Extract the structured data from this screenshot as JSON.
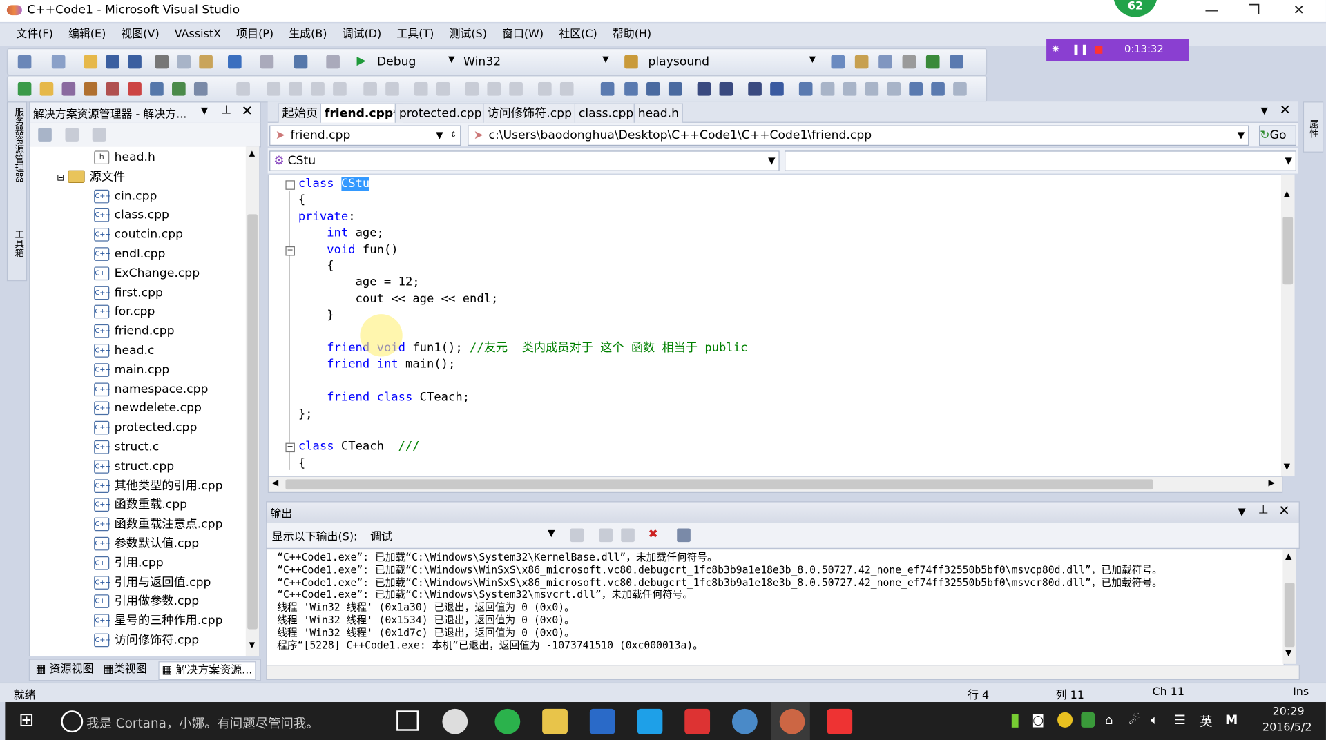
{
  "window": {
    "title": "C++Code1 - Microsoft Visual Studio",
    "badge": "62"
  },
  "menu": [
    "文件(F)",
    "编辑(E)",
    "视图(V)",
    "VAssistX",
    "项目(P)",
    "生成(B)",
    "调试(D)",
    "工具(T)",
    "测试(S)",
    "窗口(W)",
    "社区(C)",
    "帮助(H)"
  ],
  "toolbar": {
    "config": "Debug",
    "platform": "Win32",
    "find": "playsound"
  },
  "recorder": {
    "time": "0:13:32"
  },
  "solution_explorer": {
    "title": "解决方案资源管理器 - 解决方...",
    "items": [
      {
        "label": "head.h",
        "icon": "h"
      },
      {
        "label": "源文件",
        "icon": "folder"
      },
      {
        "label": "cin.cpp",
        "icon": "cpp"
      },
      {
        "label": "class.cpp",
        "icon": "cpp"
      },
      {
        "label": "coutcin.cpp",
        "icon": "cpp"
      },
      {
        "label": "endl.cpp",
        "icon": "cpp"
      },
      {
        "label": "ExChange.cpp",
        "icon": "cpp"
      },
      {
        "label": "first.cpp",
        "icon": "cpp"
      },
      {
        "label": "for.cpp",
        "icon": "cpp"
      },
      {
        "label": "friend.cpp",
        "icon": "cpp"
      },
      {
        "label": "head.c",
        "icon": "cpp"
      },
      {
        "label": "main.cpp",
        "icon": "cpp"
      },
      {
        "label": "namespace.cpp",
        "icon": "cpp"
      },
      {
        "label": "newdelete.cpp",
        "icon": "cpp"
      },
      {
        "label": "protected.cpp",
        "icon": "cpp"
      },
      {
        "label": "struct.c",
        "icon": "cpp"
      },
      {
        "label": "struct.cpp",
        "icon": "cpp"
      },
      {
        "label": "其他类型的引用.cpp",
        "icon": "cpp"
      },
      {
        "label": "函数重载.cpp",
        "icon": "cpp"
      },
      {
        "label": "函数重载注意点.cpp",
        "icon": "cpp"
      },
      {
        "label": "参数默认值.cpp",
        "icon": "cpp"
      },
      {
        "label": "引用.cpp",
        "icon": "cpp"
      },
      {
        "label": "引用与返回值.cpp",
        "icon": "cpp"
      },
      {
        "label": "引用做参数.cpp",
        "icon": "cpp"
      },
      {
        "label": "星号的三种作用.cpp",
        "icon": "cpp"
      },
      {
        "label": "访问修饰符.cpp",
        "icon": "cpp"
      }
    ],
    "bottom_tabs": [
      "资源视图",
      "类视图",
      "解决方案资源..."
    ]
  },
  "left_strip": [
    "服务器资源管理器",
    "工具箱"
  ],
  "right_strip": [
    "属性"
  ],
  "editor": {
    "tabs": [
      "起始页",
      "friend.cpp*",
      "protected.cpp",
      "访问修饰符.cpp",
      "class.cpp",
      "head.h"
    ],
    "file_combo": "friend.cpp",
    "path": "c:\\Users\\baodonghua\\Desktop\\C++Code1\\C++Code1\\friend.cpp",
    "go": "Go",
    "class_combo": "CStu",
    "code": [
      {
        "parts": [
          [
            "kw",
            "class "
          ],
          [
            "sel",
            "CStu"
          ]
        ]
      },
      {
        "parts": [
          [
            "",
            "{"
          ]
        ]
      },
      {
        "parts": [
          [
            "kw",
            "private"
          ],
          [
            "",
            ":"
          ]
        ]
      },
      {
        "parts": [
          [
            "",
            "    "
          ],
          [
            "kw",
            "int"
          ],
          [
            "",
            " age;"
          ]
        ]
      },
      {
        "parts": [
          [
            "",
            "    "
          ],
          [
            "kw",
            "void"
          ],
          [
            "",
            " fun()"
          ]
        ]
      },
      {
        "parts": [
          [
            "",
            "    {"
          ]
        ]
      },
      {
        "parts": [
          [
            "",
            "        age = 12;"
          ]
        ]
      },
      {
        "parts": [
          [
            "",
            "        cout << age << endl;"
          ]
        ]
      },
      {
        "parts": [
          [
            "",
            "    }"
          ]
        ]
      },
      {
        "parts": [
          [
            "",
            ""
          ]
        ]
      },
      {
        "parts": [
          [
            "",
            "    "
          ],
          [
            "kw",
            "friend"
          ],
          [
            "",
            " "
          ],
          [
            "kw",
            "void"
          ],
          [
            "",
            " fun1(); "
          ],
          [
            "cm",
            "//友元  类内成员对于 这个 函数 相当于 public"
          ]
        ]
      },
      {
        "parts": [
          [
            "",
            "    "
          ],
          [
            "kw",
            "friend"
          ],
          [
            "",
            " "
          ],
          [
            "kw",
            "int"
          ],
          [
            "",
            " main();"
          ]
        ]
      },
      {
        "parts": [
          [
            "",
            ""
          ]
        ]
      },
      {
        "parts": [
          [
            "",
            "    "
          ],
          [
            "kw",
            "friend"
          ],
          [
            "",
            " "
          ],
          [
            "kw",
            "class"
          ],
          [
            "",
            " CTeach;"
          ]
        ]
      },
      {
        "parts": [
          [
            "",
            "};"
          ]
        ]
      },
      {
        "parts": [
          [
            "",
            ""
          ]
        ]
      },
      {
        "parts": [
          [
            "kw",
            "class"
          ],
          [
            "",
            " CTeach  "
          ],
          [
            "cm",
            "///"
          ]
        ]
      },
      {
        "parts": [
          [
            "",
            "{"
          ]
        ]
      }
    ]
  },
  "output": {
    "title": "输出",
    "show_label": "显示以下输出(S):",
    "show_value": "调试",
    "lines": [
      "“C++Code1.exe”: 已加载“C:\\Windows\\System32\\KernelBase.dll”，未加载任何符号。",
      "“C++Code1.exe”: 已加载“C:\\Windows\\WinSxS\\x86_microsoft.vc80.debugcrt_1fc8b3b9a1e18e3b_8.0.50727.42_none_ef74ff32550b5bf0\\msvcp80d.dll”，已加载符号。",
      "“C++Code1.exe”: 已加载“C:\\Windows\\WinSxS\\x86_microsoft.vc80.debugcrt_1fc8b3b9a1e18e3b_8.0.50727.42_none_ef74ff32550b5bf0\\msvcr80d.dll”，已加载符号。",
      "“C++Code1.exe”: 已加载“C:\\Windows\\System32\\msvcrt.dll”，未加载任何符号。",
      "线程 'Win32 线程' (0x1a30) 已退出，返回值为 0 (0x0)。",
      "线程 'Win32 线程' (0x1534) 已退出，返回值为 0 (0x0)。",
      "线程 'Win32 线程' (0x1d7c) 已退出，返回值为 0 (0x0)。",
      "程序“[5228] C++Code1.exe: 本机”已退出，返回值为 -1073741510 (0xc000013a)。"
    ]
  },
  "status": {
    "ready": "就绪",
    "line": "行 4",
    "col": "列 11",
    "ch": "Ch 11",
    "ins": "Ins"
  },
  "taskbar": {
    "cortana": "我是 Cortana，小娜。有问题尽管问我。",
    "lang": "英",
    "ime": "M",
    "time": "20:29",
    "date": "2016/5/2"
  }
}
